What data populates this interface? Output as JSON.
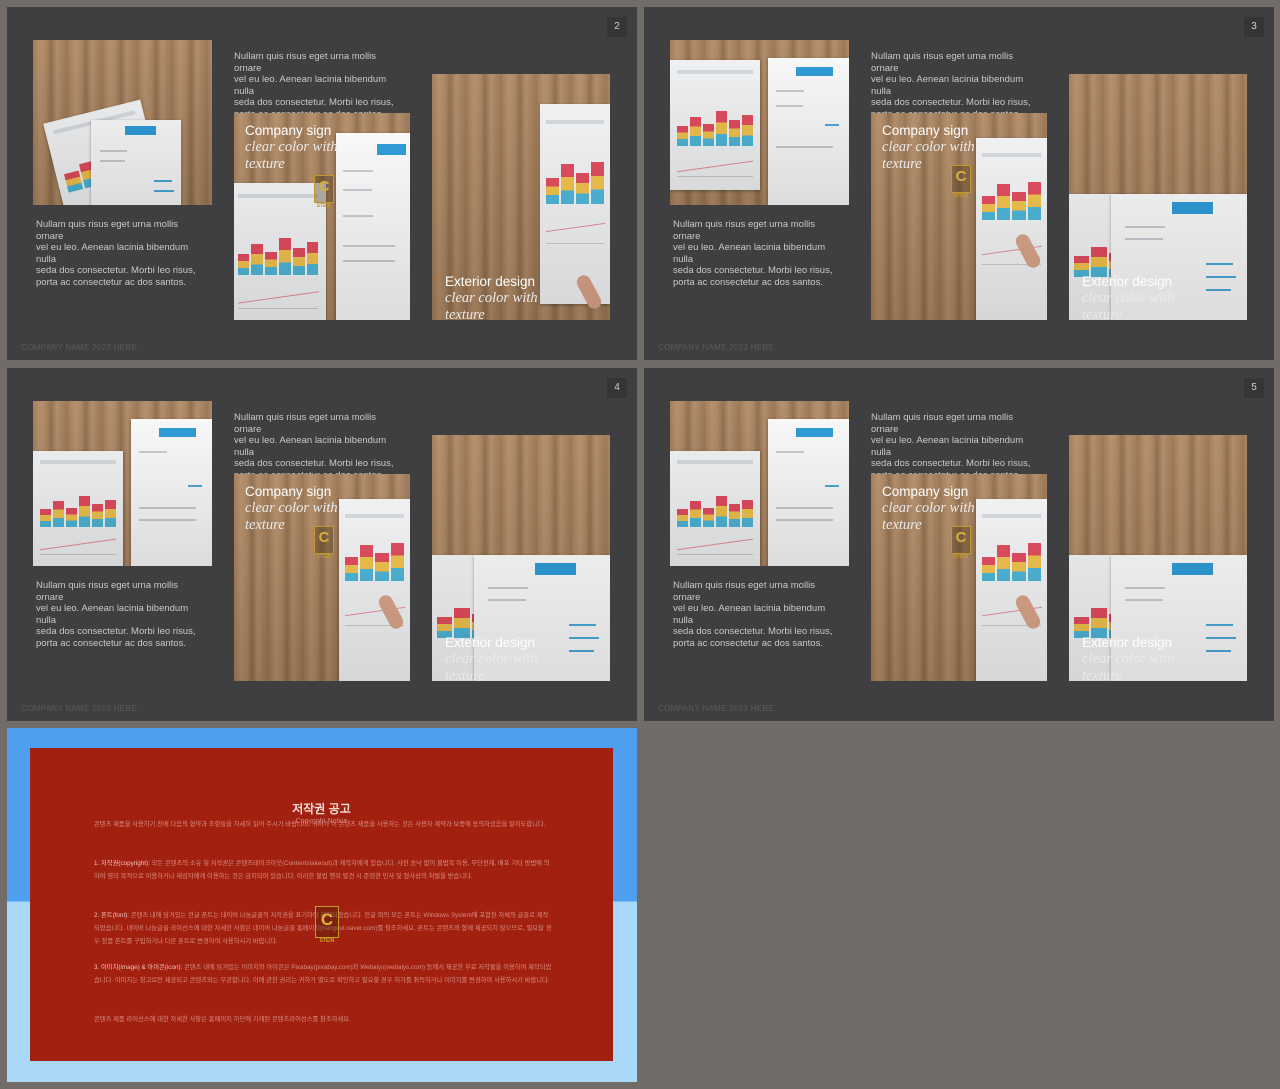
{
  "slides": [
    {
      "number": "2",
      "footer": "COMPANY NAME 2023 HERE"
    },
    {
      "number": "3",
      "footer": "COMPANY NAME 2023 HERE"
    },
    {
      "number": "4",
      "footer": "COMPANY NAME 2023 HERE"
    },
    {
      "number": "5",
      "footer": "COMPANY NAME 2023 HERE"
    }
  ],
  "text": {
    "paragraph": "Nullam quis risus eget urna mollis ornare\nvel eu leo. Aenean lacinia bibendum nulla\nseda dos consectetur. Morbi leo risus,\nporta ac consectetur ac dos santos.",
    "caption1_title": "Company sign",
    "caption1_sub": "clear color with\ntexture",
    "caption2_title": "Exterior design",
    "caption2_sub": "clear color with\ntexture",
    "logo_letter": "C",
    "logo_small": "STEIN"
  },
  "copyright": {
    "title": "저작권 공고",
    "subtitle": "Copyright Notice",
    "intro": "콘텐츠 제품을 사용하기 전에 다음의 협약과 조항들을 자세히 읽어 주시기 바랍니다. 귀하가 이 콘텐츠 제품을 사용하는 것은 사용자 계약과 보증에 동의하셨음을 말하도합니다.",
    "s1_label": "1. 저작권(copyright):",
    "s1_text": " 모든 콘텐츠의 소유 및 저작권은 콘텐츠테이크아웃(Contentstakeout)과 제작자에게 있습니다. 사전 승낙 없이 불법복 이용, 무단전재, 배포 기타 방법에 의하여 영리 목적으로 이용하거나 재상자에게 이용하는 것은 금지되어 있습니다. 이러한 불법 행위 발견 시 준엄한 민사 및 형사상의 처벌을 받습니다.",
    "s2_label": "2. 폰트(font):",
    "s2_text": " 콘텐츠 내에 담겨있는 한글 폰트는 네이버 나눔글꼴의 저작권을 표기하여 제작되었습니다. 한글 외의 모든 폰트는 Windows System에 포함된 자체의 글꼴로 제작되었습니다. 네이버 나눔글꼴 라이선스에 대한 자세한 사항은 네이버 나눔글꼴 홈페이지(hangeul.naver.com)를 참조하세요. 폰트는 콘텐츠와 함께 제공되지 않으므로, 필요할 경우 정품 폰트를 구입하거나 다른 폰트로 변경하여 사용하시기 바랍니다.",
    "s3_label": "3. 이미지(image) & 아이콘(icon):",
    "s3_text": " 콘텐츠 내에 담겨있는 이미지와 아이콘은 Pixabay(pixabay.com)와 Webalys(webalys.com) 등에서 제공한 무료 저작물을 이용하여 제작되었습니다. 이미지는 참고로만 제공되고 콘텐츠와는 무관합니다. 이에 관한 권리는 귀하가 별도로 확인하고 필요할 경우 허가를 취득하거나 이미지를 변경하여 사용하시기 바랍니다.",
    "outro": "콘텐츠 제품 라이선스에 대한 자세한 사항은 홈페이지 하단에 기재된 콘텐츠라이선스를 참조하세요."
  },
  "colors": {
    "slide_bg": "#3f3f41",
    "canvas_bg": "#726c69",
    "copyright_red": "#a12010",
    "copyright_blue": "#4f9ff0",
    "copyright_lightblue": "#a9d8f8"
  }
}
